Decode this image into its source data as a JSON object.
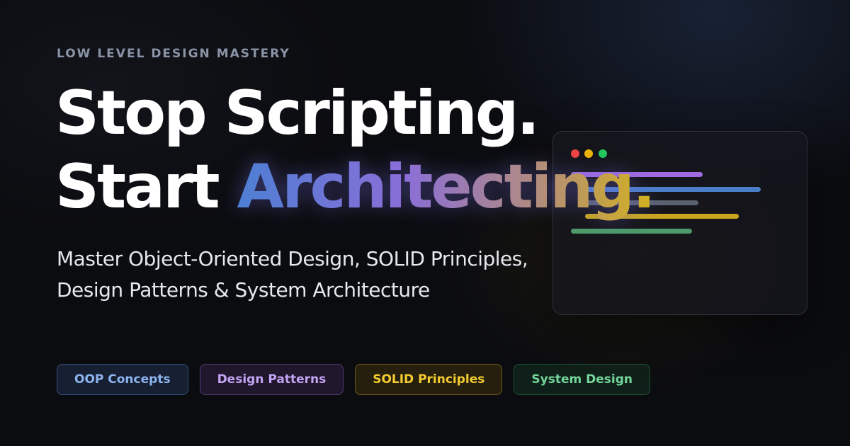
{
  "eyebrow": "LOW LEVEL DESIGN MASTERY",
  "headline": {
    "line1": "Stop Scripting.",
    "line2_plain": "Start ",
    "line2_gradient": "Architecting."
  },
  "subtitle": {
    "line1": "Master Object-Oriented Design, SOLID Principles,",
    "line2": "Design Patterns & System Architecture"
  },
  "code_window": {
    "dots": [
      "#ef4444",
      "#eab308",
      "#22c55e"
    ],
    "line_colors": [
      "#a855f7",
      "#3b82f6",
      "#6b7280",
      "#eab308",
      "#4ade80"
    ]
  },
  "tags": [
    {
      "label": "OOP Concepts",
      "color": "#8cb4f0"
    },
    {
      "label": "Design Patterns",
      "color": "#c4a4f4"
    },
    {
      "label": "SOLID Principles",
      "color": "#f4cc30"
    },
    {
      "label": "System Design",
      "color": "#74d69a"
    }
  ],
  "colors": {
    "background": "#0b0c10",
    "headline": "#ffffff",
    "gradient": [
      "#4d7fd4",
      "#8a6ed8",
      "#b08a84",
      "#d2b21e"
    ],
    "eyebrow": "#8a94a6"
  }
}
